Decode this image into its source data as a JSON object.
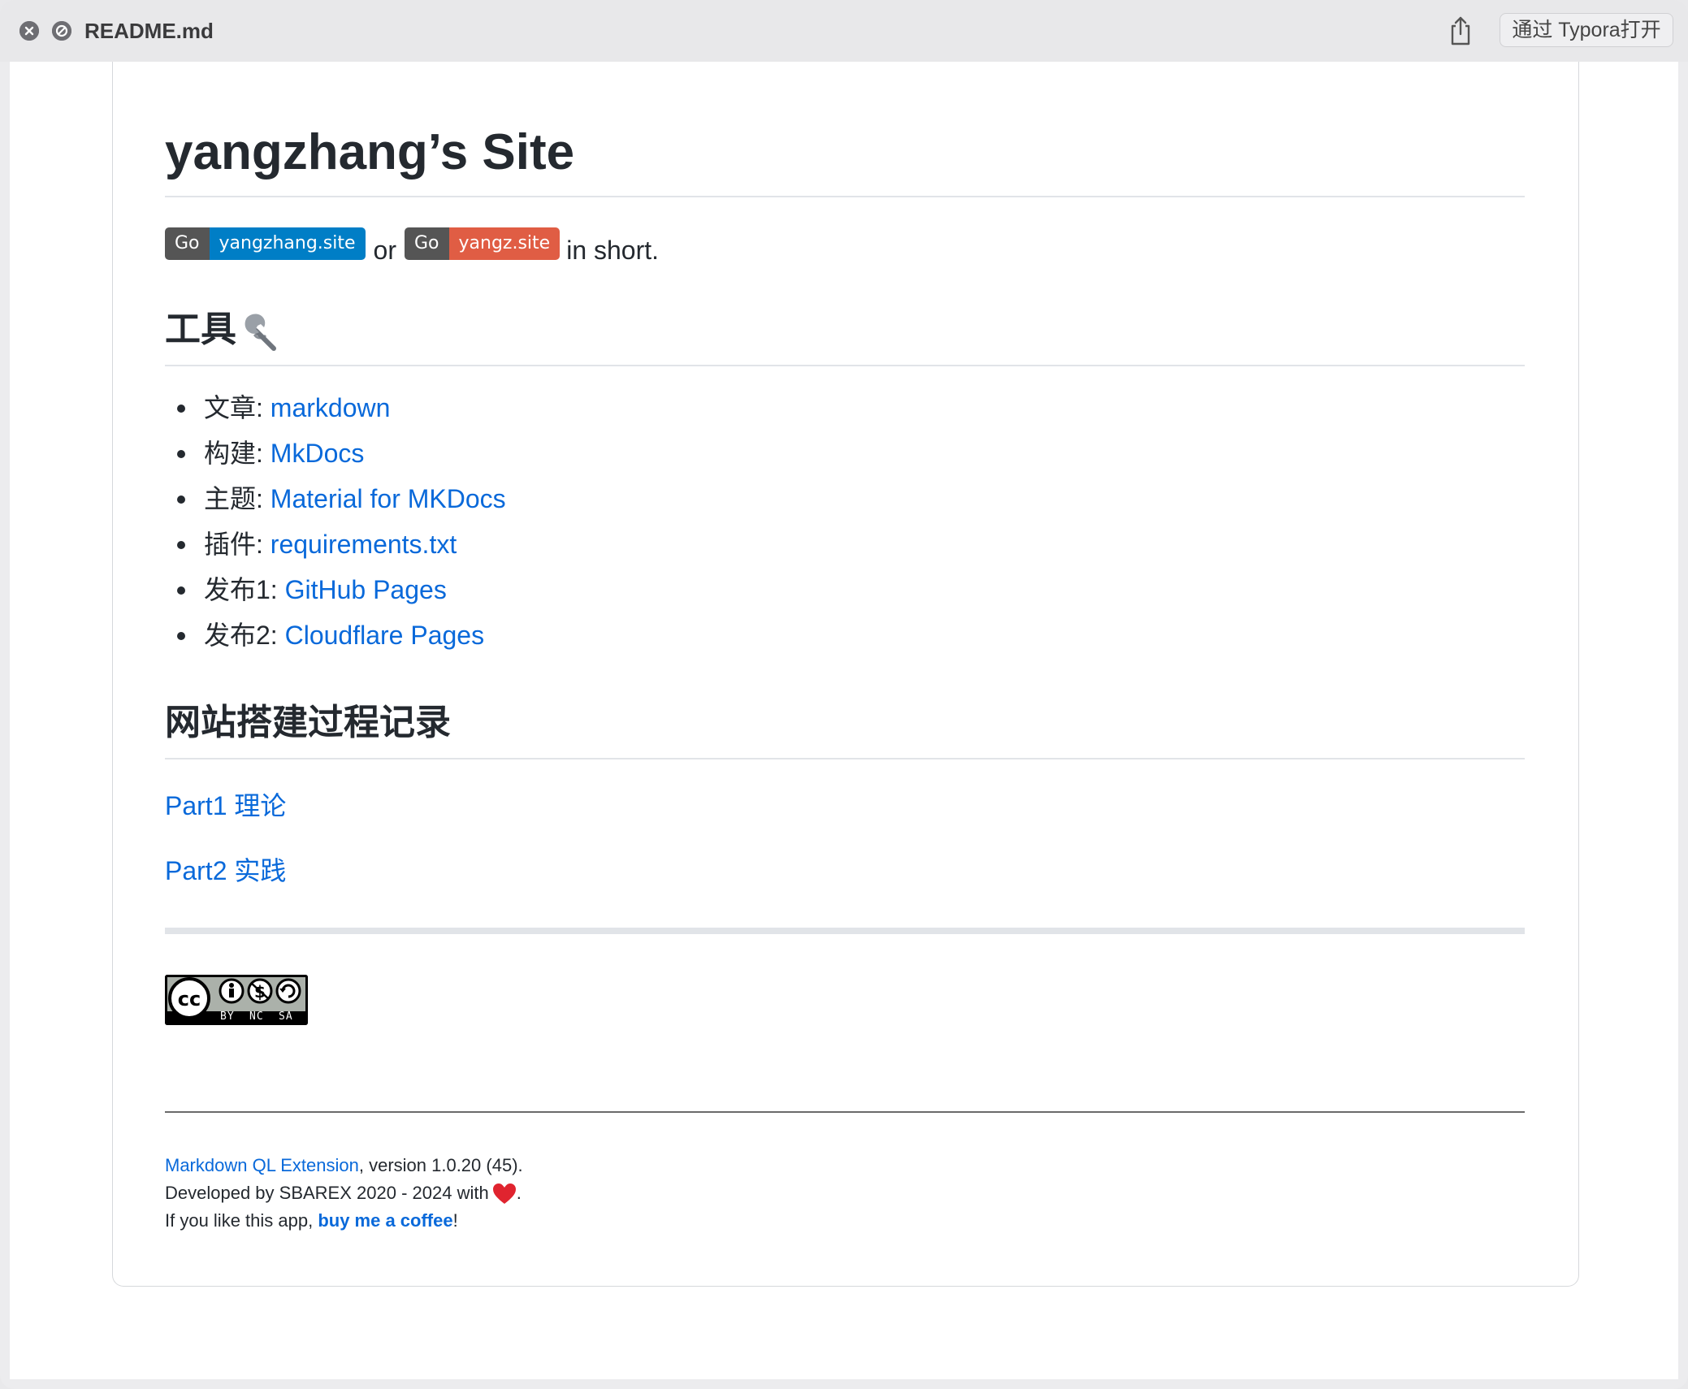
{
  "window": {
    "title": "README.md",
    "open_button": "通过 Typora打开"
  },
  "doc": {
    "title": "yangzhang’s Site",
    "badge1": {
      "left": "Go",
      "right": "yangzhang.site"
    },
    "badge2": {
      "left": "Go",
      "right": "yangz.site"
    },
    "or_text": "or",
    "short_text": "in short.",
    "tools_heading": "工具",
    "tools": [
      {
        "label": "文章: ",
        "link": "markdown"
      },
      {
        "label": "构建: ",
        "link": "MkDocs"
      },
      {
        "label": "主题: ",
        "link": "Material for MKDocs"
      },
      {
        "label": "插件: ",
        "link": "requirements.txt"
      },
      {
        "label": "发布1: ",
        "link": "GitHub Pages"
      },
      {
        "label": "发布2: ",
        "link": "Cloudflare Pages"
      }
    ],
    "record_heading": "网站搭建过程记录",
    "part1": "Part1 理论",
    "part2": "Part2 实践",
    "cc_labels": [
      "BY",
      "NC",
      "SA"
    ]
  },
  "footer": {
    "ext_link": "Markdown QL Extension",
    "version_text": ", version 1.0.20 (45).",
    "developed_text": "Developed by SBAREX 2020 - 2024 with",
    "developed_end": ".",
    "like_text": "If you like this app, ",
    "coffee_link": "buy me a coffee",
    "like_end": "!"
  },
  "colors": {
    "link": "#0969da",
    "badge_blue": "#007ec6",
    "badge_red": "#e05d44",
    "badge_gray": "#555555"
  }
}
